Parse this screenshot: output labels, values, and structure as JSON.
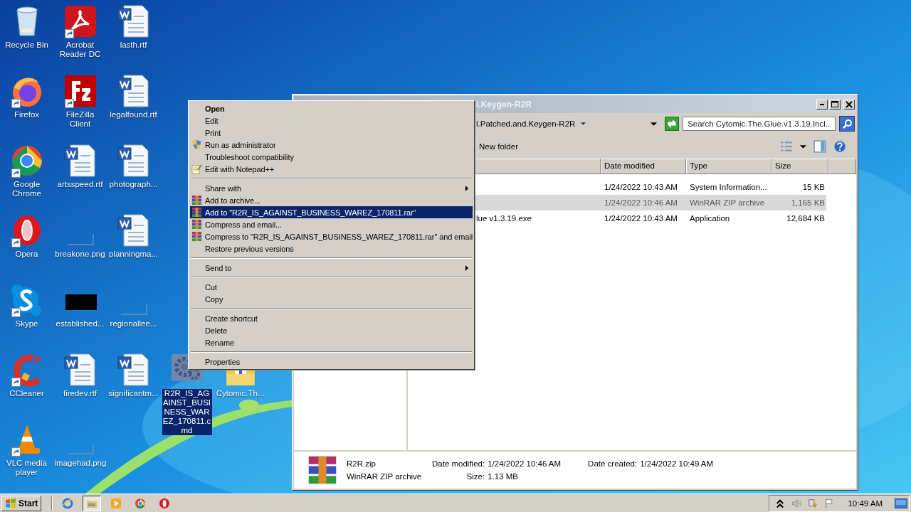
{
  "desktop": {
    "icons": [
      {
        "label": "Recycle Bin",
        "kind": "recycle",
        "shortcut": false,
        "selected": false
      },
      {
        "label": "Acrobat Reader DC",
        "kind": "acrobat",
        "shortcut": true,
        "selected": false
      },
      {
        "label": "lasth.rtf",
        "kind": "word",
        "shortcut": false,
        "selected": false
      },
      {
        "label": "Firefox",
        "kind": "firefox",
        "shortcut": true,
        "selected": false
      },
      {
        "label": "FileZilla Client",
        "kind": "filezilla",
        "shortcut": true,
        "selected": false
      },
      {
        "label": "legalfound.rtf",
        "kind": "word",
        "shortcut": false,
        "selected": false
      },
      {
        "label": "Google Chrome",
        "kind": "chrome",
        "shortcut": true,
        "selected": false
      },
      {
        "label": "artsspeed.rtf",
        "kind": "word",
        "shortcut": false,
        "selected": false
      },
      {
        "label": "photograph...",
        "kind": "word",
        "shortcut": false,
        "selected": false
      },
      {
        "label": "Opera",
        "kind": "opera",
        "shortcut": true,
        "selected": false
      },
      {
        "label": "breakone.png",
        "kind": "blank",
        "shortcut": false,
        "selected": false
      },
      {
        "label": "planningma...",
        "kind": "word",
        "shortcut": false,
        "selected": false
      },
      {
        "label": "Skype",
        "kind": "skype",
        "shortcut": true,
        "selected": false
      },
      {
        "label": "established...",
        "kind": "black",
        "shortcut": false,
        "selected": false
      },
      {
        "label": "regionallee...",
        "kind": "blank",
        "shortcut": false,
        "selected": false
      },
      {
        "label": "CCleaner",
        "kind": "ccleaner",
        "shortcut": true,
        "selected": false
      },
      {
        "label": "firedev.rtf",
        "kind": "word",
        "shortcut": false,
        "selected": false
      },
      {
        "label": "significantm...",
        "kind": "word",
        "shortcut": false,
        "selected": false
      },
      {
        "label": "R2R_IS_AGAINST_BUSINESS_WAREZ_170811.cmd",
        "kind": "gear",
        "shortcut": false,
        "selected": true
      },
      {
        "label": "Cytomic.Th...",
        "kind": "folder",
        "shortcut": false,
        "selected": false
      },
      {
        "label": "VLC media player",
        "kind": "vlc",
        "shortcut": true,
        "selected": false
      },
      {
        "label": "imagehad.png",
        "kind": "blank",
        "shortcut": false,
        "selected": false
      }
    ]
  },
  "explorer": {
    "title": "l.Keygen-R2R",
    "address": "l.Patched.and.Keygen-R2R",
    "search_placeholder": "Search Cytomic.The.Glue.v1.3.19.Incl...",
    "new_folder": "New folder",
    "columns": [
      "Date modified",
      "Type",
      "Size"
    ],
    "rows": [
      {
        "date": "1/24/2022 10:43 AM",
        "type": "System Information...",
        "size": "15 KB",
        "selected": false
      },
      {
        "date": "1/24/2022 10:46 AM",
        "type": "WinRAR ZIP archive",
        "size": "1,165 KB",
        "selected": true
      },
      {
        "name": "lue v1.3.19.exe",
        "date": "1/24/2022 10:43 AM",
        "type": "Application",
        "size": "12,684 KB",
        "selected": false
      }
    ],
    "details": {
      "name": "R2R.zip",
      "type": "WinRAR ZIP archive",
      "fields": [
        {
          "label": "Date modified:",
          "value": "1/24/2022 10:46 AM"
        },
        {
          "label": "Date created:",
          "value": "1/24/2022 10:49 AM"
        },
        {
          "label": "Size:",
          "value": "1.13 MB"
        }
      ]
    }
  },
  "menu": {
    "items": [
      {
        "kind": "plain",
        "label": "Open",
        "default": true,
        "submenu": false,
        "selected": false
      },
      {
        "kind": "plain",
        "label": "Edit",
        "default": false,
        "submenu": false,
        "selected": false
      },
      {
        "kind": "plain",
        "label": "Print",
        "default": false,
        "submenu": false,
        "selected": false
      },
      {
        "kind": "shield",
        "label": "Run as administrator",
        "default": false,
        "submenu": false,
        "selected": false
      },
      {
        "kind": "plain",
        "label": "Troubleshoot compatibility",
        "default": false,
        "submenu": false,
        "selected": false
      },
      {
        "kind": "notepad",
        "label": "Edit with Notepad++",
        "default": false,
        "submenu": false,
        "selected": false
      },
      {
        "kind": "separator"
      },
      {
        "kind": "plain",
        "label": "Share with",
        "default": false,
        "submenu": true,
        "selected": false
      },
      {
        "kind": "archiver",
        "label": "Add to archive...",
        "default": false,
        "submenu": false,
        "selected": false
      },
      {
        "kind": "archiver",
        "label": "Add to \"R2R_IS_AGAINST_BUSINESS_WAREZ_170811.rar\"",
        "default": false,
        "submenu": false,
        "selected": true
      },
      {
        "kind": "archiver",
        "label": "Compress and email...",
        "default": false,
        "submenu": false,
        "selected": false
      },
      {
        "kind": "archiver",
        "label": "Compress to \"R2R_IS_AGAINST_BUSINESS_WAREZ_170811.rar\" and email",
        "default": false,
        "submenu": false,
        "selected": false
      },
      {
        "kind": "plain",
        "label": "Restore previous versions",
        "default": false,
        "submenu": false,
        "selected": false
      },
      {
        "kind": "separator"
      },
      {
        "kind": "plain",
        "label": "Send to",
        "default": false,
        "submenu": true,
        "selected": false
      },
      {
        "kind": "separator"
      },
      {
        "kind": "plain",
        "label": "Cut",
        "default": false,
        "submenu": false,
        "selected": false
      },
      {
        "kind": "plain",
        "label": "Copy",
        "default": false,
        "submenu": false,
        "selected": false
      },
      {
        "kind": "separator"
      },
      {
        "kind": "plain",
        "label": "Create shortcut",
        "default": false,
        "submenu": false,
        "selected": false
      },
      {
        "kind": "plain",
        "label": "Delete",
        "default": false,
        "submenu": false,
        "selected": false
      },
      {
        "kind": "plain",
        "label": "Rename",
        "default": false,
        "submenu": false,
        "selected": false
      },
      {
        "kind": "separator"
      },
      {
        "kind": "plain",
        "label": "Properties",
        "default": false,
        "submenu": false,
        "selected": false
      }
    ]
  },
  "taskbar": {
    "start": "Start",
    "apps": [
      {
        "kind": "ie",
        "active": false
      },
      {
        "kind": "explorer",
        "active": true
      },
      {
        "kind": "media",
        "active": false
      },
      {
        "kind": "chrome",
        "active": false
      },
      {
        "kind": "opera",
        "active": false
      }
    ],
    "clock": "10:49 AM"
  }
}
